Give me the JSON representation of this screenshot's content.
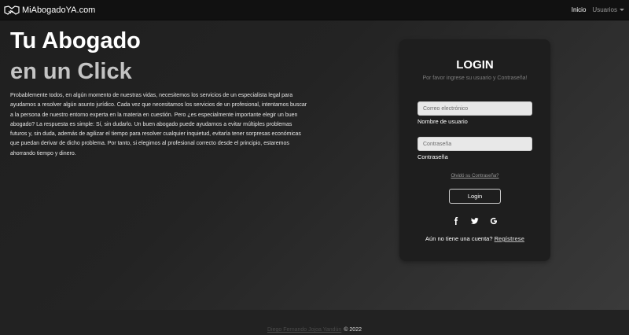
{
  "navbar": {
    "brand": "MiAbogadoYA.com",
    "links": [
      {
        "label": "Inicio"
      },
      {
        "label": "Usuarios"
      }
    ]
  },
  "hero": {
    "line1": "Tu Abogado",
    "line2": "en un Click",
    "paragraph": "Probablemente todos, en algún momento de nuestras vidas, necesitemos los servicios de un especialista legal para ayudarnos a resolver algún asunto jurídico. Cada vez que necesitamos los servicios de un profesional, intentamos buscar a la persona de nuestro entorno experta en la materia en cuestión. Pero ¿es especialmente importante elegir un buen abogado? La respuesta es simple: Sí, sin dudarlo. Un buen abogado puede ayudarnos a evitar múltiples problemas futuros y, sin duda, además de agilizar el tiempo para resolver cualquier inquietud, evitaría tener sorpresas económicas que puedan derivar de dicho problema. Por tanto, si elegimos al profesional correcto desde el principio, estaremos ahorrando tiempo y dinero."
  },
  "login": {
    "title": "LOGIN",
    "subtitle": "Por favor ingrese su usuario y Contraseña!",
    "email_placeholder": "Correo electrónico",
    "user_label": "Nombre de usuario",
    "password_placeholder": "Contraseña",
    "password_label": "Contraseña",
    "forgot": "Olvidó su Contraseña?",
    "button": "Login",
    "register_prompt": "Aún no tiene una cuenta?",
    "register_link": "Regístrese",
    "socials": [
      "facebook-icon",
      "twitter-icon",
      "google-icon"
    ]
  },
  "footer": {
    "author": "Diego Fernando Jojoa Yandún",
    "copyright": "© 2022"
  }
}
